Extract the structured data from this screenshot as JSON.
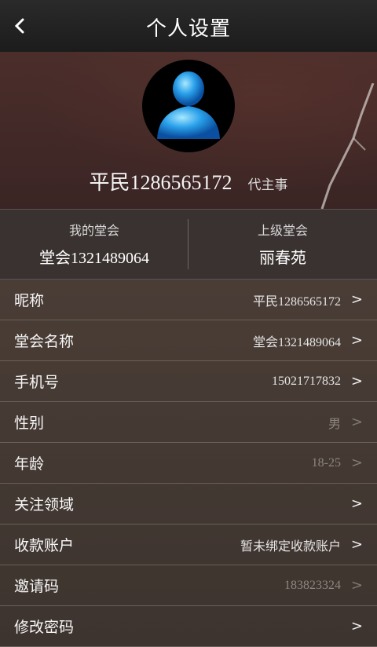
{
  "header": {
    "title": "个人设置",
    "back_icon": "‹"
  },
  "profile": {
    "avatar_icon": "person-icon",
    "name": "平民1286565172",
    "role": "代主事"
  },
  "groups": {
    "mine": {
      "label": "我的堂会",
      "value": "堂会1321489064"
    },
    "parent": {
      "label": "上级堂会",
      "value": "丽春苑"
    }
  },
  "settings": [
    {
      "label": "昵称",
      "value": "平民1286565172",
      "chevron": ">"
    },
    {
      "label": "堂会名称",
      "value": "堂会1321489064",
      "chevron": ">"
    },
    {
      "label": "手机号",
      "value": "15021717832",
      "chevron": ">"
    },
    {
      "label": "性别",
      "value": "男",
      "chevron": ">"
    },
    {
      "label": "年龄",
      "value": "18-25",
      "chevron": ">"
    },
    {
      "label": "关注领域",
      "value": "",
      "chevron": ">"
    },
    {
      "label": "收款账户",
      "value": "暂未绑定收款账户",
      "chevron": ">"
    },
    {
      "label": "邀请码",
      "value": "183823324",
      "chevron": ">"
    },
    {
      "label": "修改密码",
      "value": "",
      "chevron": ">"
    }
  ]
}
